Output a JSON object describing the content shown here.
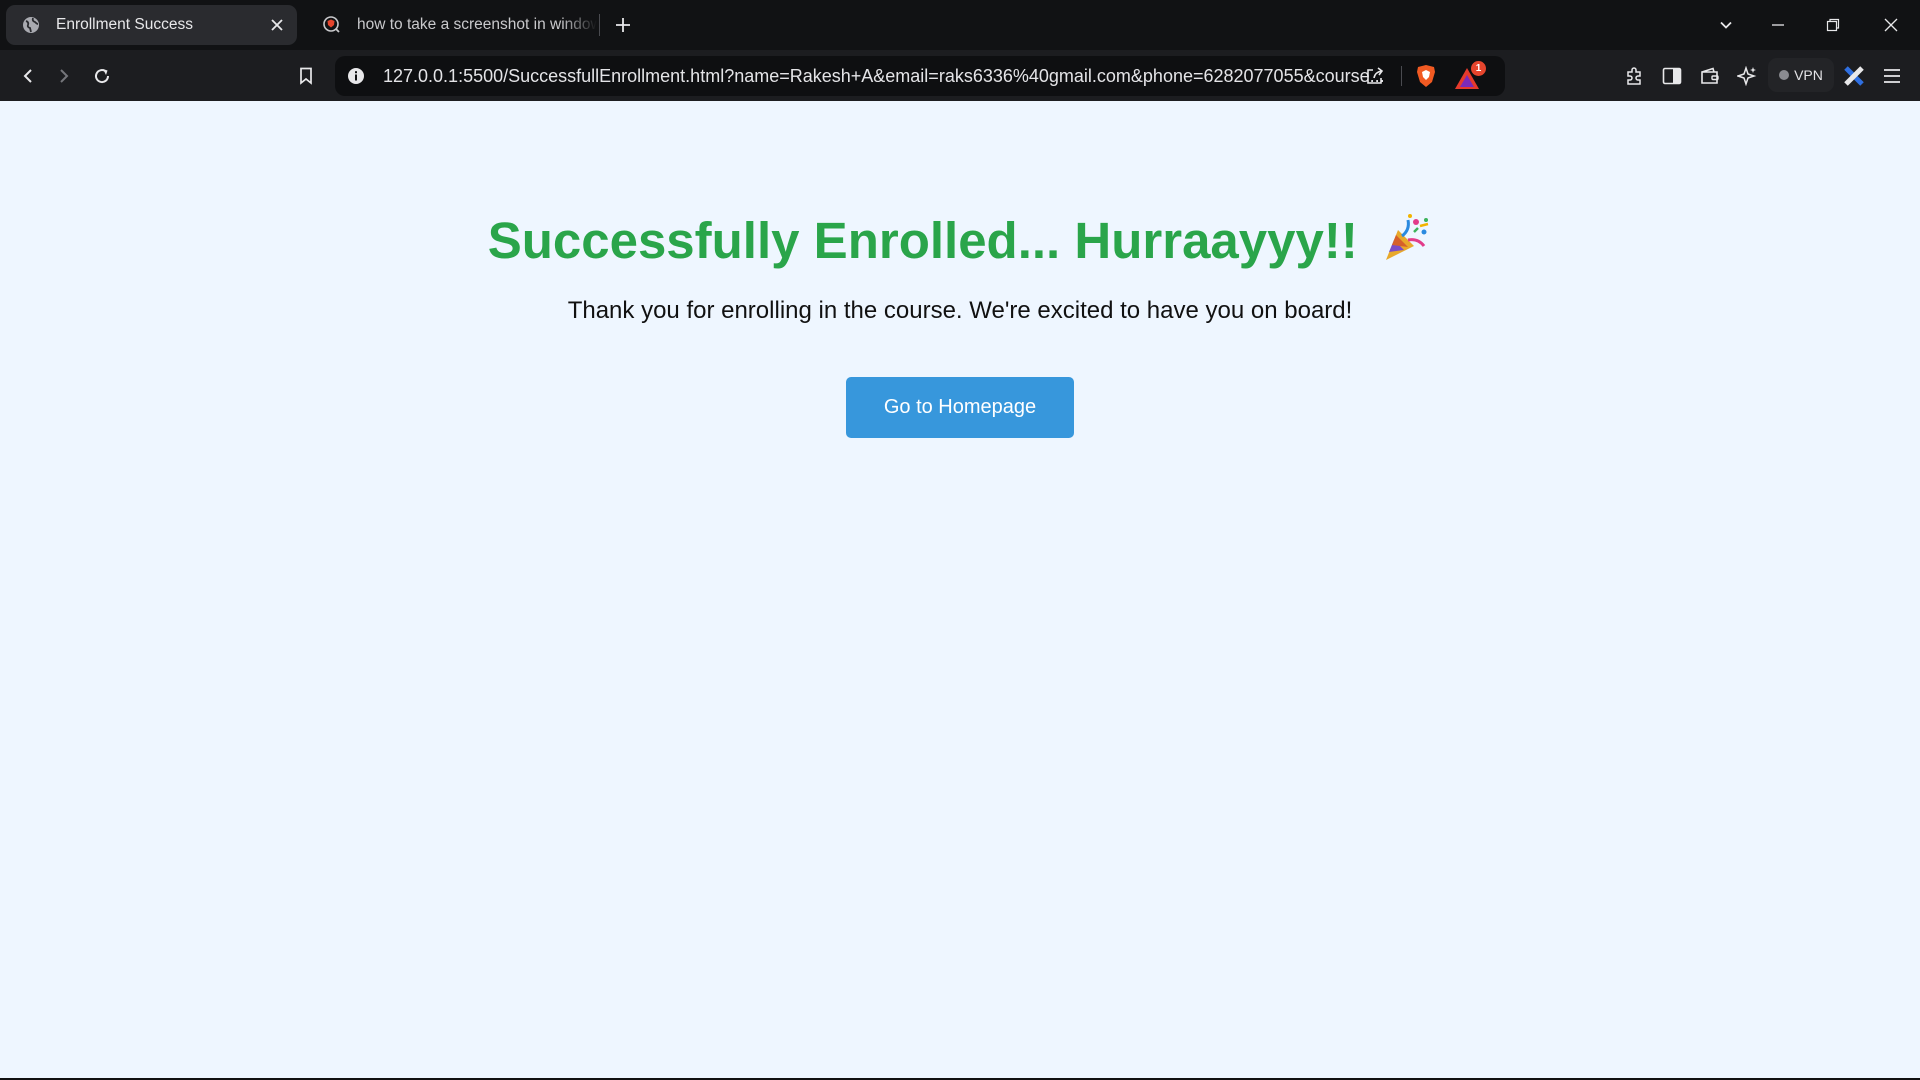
{
  "browser": {
    "tabs": [
      {
        "title": "Enrollment Success",
        "active": true,
        "icon": "globe-icon"
      },
      {
        "title": "how to take a screenshot in windows",
        "active": false,
        "icon": "brave-search-icon"
      }
    ],
    "address_bar": {
      "url": "127.0.0.1:5500/SuccessfullEnrollment.html?name=Rakesh+A&email=raks6336%40gmail.com&phone=6282077055&course..."
    },
    "rewards_badge": "1",
    "vpn_label": "VPN"
  },
  "page": {
    "heading": "Successfully Enrolled... Hurraayyy!!",
    "heading_emoji": "party-popper-icon",
    "subtitle": "Thank you for enrolling in the course. We're excited to have you on board!",
    "button_label": "Go to Homepage",
    "colors": {
      "heading": "#2aa54a",
      "button": "#3797dc",
      "background": "#eef6ff"
    }
  }
}
